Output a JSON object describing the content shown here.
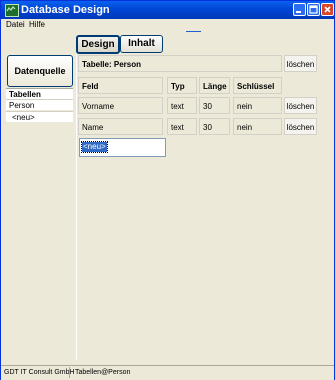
{
  "window": {
    "title": "Database Design"
  },
  "menu": [
    "Datei",
    "Hilfe"
  ],
  "tabs": [
    "Design",
    "Inhalt"
  ],
  "left": {
    "source_button": "Datenquelle",
    "list_header": "Tabellen",
    "items": [
      "Person",
      "<neu>"
    ]
  },
  "table": {
    "label": "Tabelle: Person",
    "delete_label": "löschen",
    "columns": [
      "Feld",
      "Typ",
      "Länge",
      "Schlüssel"
    ],
    "rows": [
      {
        "feld": "Vorname",
        "typ": "text",
        "laenge": "30",
        "schluessel": "nein",
        "action": "löschen"
      },
      {
        "feld": "Name",
        "typ": "text",
        "laenge": "30",
        "schluessel": "nein",
        "action": "löschen"
      }
    ],
    "new_field_value": "<neu>"
  },
  "status": [
    "GDT IT Consult GmbH",
    "Tabellen@Person"
  ],
  "colors": {
    "titlebar": "#0046d5",
    "selection": "#316ac5",
    "face": "#ece9d8"
  }
}
